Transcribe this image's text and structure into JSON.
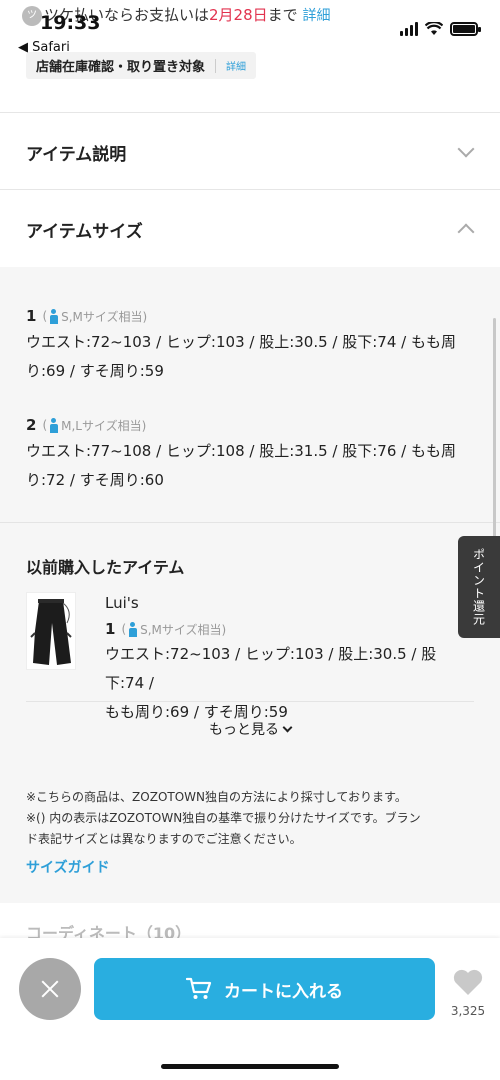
{
  "status_bar": {
    "time": "19:33",
    "back_label": "◀ Safari",
    "promo_logo": "ツ",
    "promo_text": "ツケ払いならお支払いは",
    "promo_date": "2月28日",
    "promo_suffix": "まで",
    "promo_detail": "詳細"
  },
  "store_tag": {
    "label": "店舗在庫確認・取り置き対象",
    "link": "詳細"
  },
  "sections": {
    "description_title": "アイテム説明",
    "size_title": "アイテムサイズ"
  },
  "sizes": [
    {
      "num": "1",
      "open": "(",
      "equiv": "S,Mサイズ相当)",
      "measure_line1": "ウエスト:72~103 / ヒップ:103 / 股上:30.5 / 股下:74 / もも周",
      "measure_line2": "り:69 / すそ周り:59"
    },
    {
      "num": "2",
      "open": "(",
      "equiv": "M,Lサイズ相当)",
      "measure_line1": "ウエスト:77~108 / ヒップ:108 / 股上:31.5 / 股下:76 / もも周",
      "measure_line2": "り:72 / すそ周り:60"
    }
  ],
  "history": {
    "title": "以前購入したアイテム",
    "brand": "Lui's",
    "num": "1",
    "open": "(",
    "equiv": "S,Mサイズ相当)",
    "measure_line1": "ウエスト:72~103 / ヒップ:103 / 股上:30.5 / 股下:74 /",
    "measure_line2": "もも周り:69 / すそ周り:59",
    "more_label": "もっと見る"
  },
  "notes": {
    "line1": "※こちらの商品は、ZOZOTOWN独自の方法により採寸しております。",
    "line2": "※() 内の表示はZOZOTOWN独自の基準で振り分けたサイズです。ブラン",
    "line3": "ド表記サイズとは異なりますのでご注意ください。",
    "guide_link": "サイズガイド"
  },
  "point_tab": "ポイント還元",
  "cut_row": "コーディネート（10）",
  "bottom_bar": {
    "cart_label": "カートに入れる",
    "favorite_count": "3,325"
  },
  "colors": {
    "accent": "#29aee0",
    "link": "#2e9fd8",
    "promo_red": "#e2334f"
  }
}
